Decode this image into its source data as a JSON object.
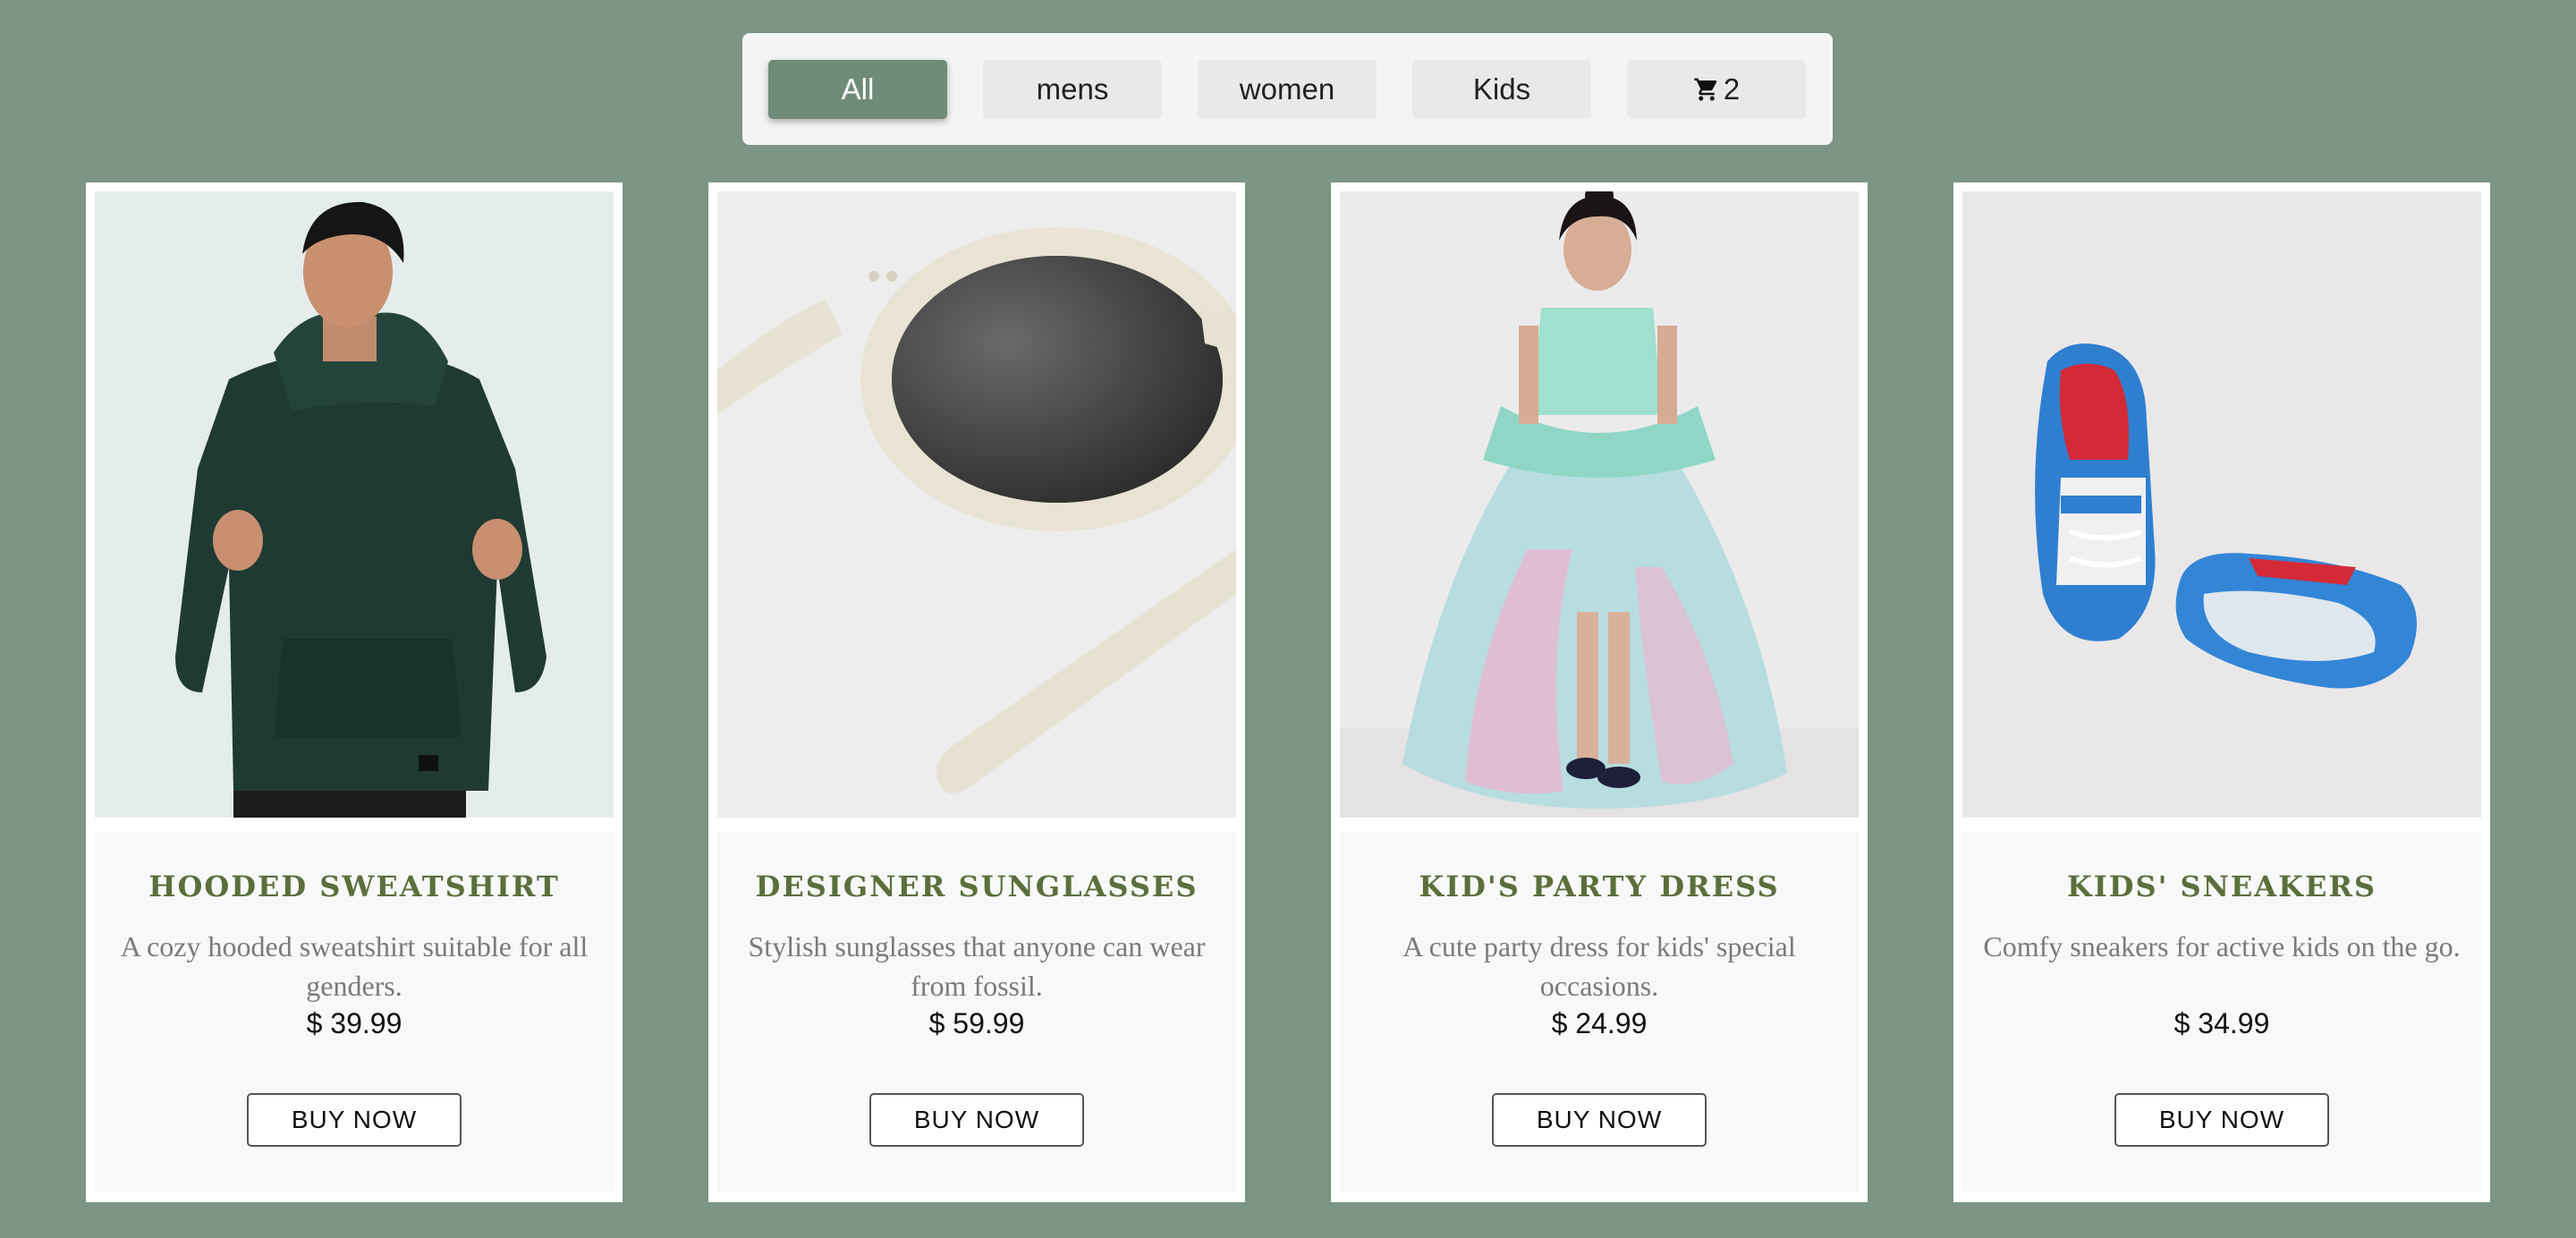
{
  "filters": {
    "all_label": "All",
    "mens_label": "mens",
    "women_label": "women",
    "kids_label": "Kids",
    "cart_icon": "cart-icon",
    "cart_count": "2",
    "active": "All"
  },
  "colors": {
    "page_background": "#7c9584",
    "active_filter": "#6e8c78",
    "title_color": "#5b6f3b"
  },
  "products": [
    {
      "image": "hooded-sweatshirt-photo",
      "title": "Hooded Sweatshirt",
      "description": "A cozy hooded sweatshirt suitable for all genders.",
      "price": "$ 39.99",
      "button_label": "BUY NOW"
    },
    {
      "image": "designer-sunglasses-photo",
      "title": "Designer Sunglasses",
      "description": "Stylish sunglasses that anyone can wear from fossil.",
      "price": "$ 59.99",
      "button_label": "BUY NOW"
    },
    {
      "image": "kids-party-dress-photo",
      "title": "Kid's Party Dress",
      "description": "A cute party dress for kids' special occasions.",
      "price": "$ 24.99",
      "button_label": "BUY NOW"
    },
    {
      "image": "kids-sneakers-photo",
      "title": "Kids' Sneakers",
      "description": "Comfy sneakers for active kids on the go.",
      "price": "$ 34.99",
      "button_label": "BUY NOW"
    }
  ]
}
